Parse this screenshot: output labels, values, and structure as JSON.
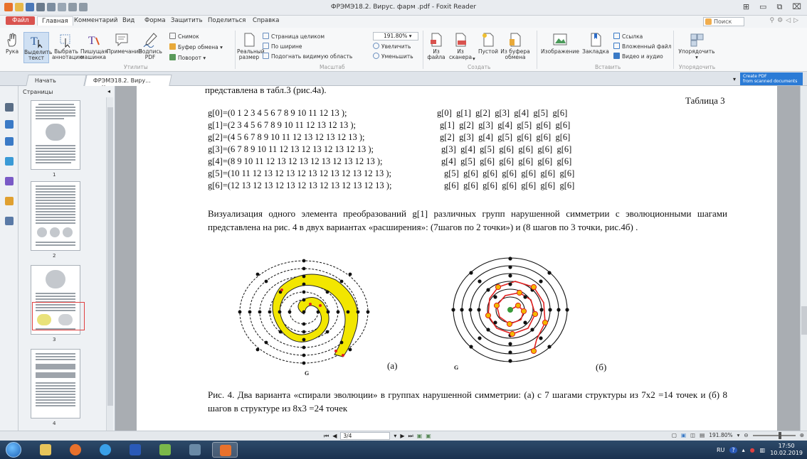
{
  "window": {
    "title": "ФРЭМЭ18.2. Вирус. фарм .pdf - Foxit Reader"
  },
  "menu": {
    "file": "Файл",
    "tabs": [
      "Главная",
      "Комментарий",
      "Вид",
      "Форма",
      "Защитить",
      "Поделиться",
      "Справка"
    ],
    "search_placeholder": "Поиск"
  },
  "ribbon": {
    "tools": {
      "hand": "Рука",
      "select_text": [
        "Выделить",
        "текст"
      ],
      "select_annot": [
        "Выбрать",
        "аннотацию"
      ],
      "typewriter": [
        "Пишущая",
        "машинка"
      ],
      "note": "Примечание",
      "sign_pdf": [
        "Подпись",
        "PDF"
      ],
      "snapshot": "Снимок",
      "clipboard": "Буфер обмена",
      "rotate": "Поворот",
      "group_label": "Утилиты"
    },
    "view": {
      "actual_size": [
        "Реальный",
        "размер"
      ],
      "fit_page": "Страница целиком",
      "fit_width": "По ширине",
      "fit_visible": "Подогнать видимую область",
      "zoom_value": "191.80%",
      "zoom_in": "Увеличить",
      "zoom_out": "Уменьшить",
      "group_label": "Масштаб"
    },
    "create": {
      "from_file": [
        "Из",
        "файла"
      ],
      "from_scanner": [
        "Из",
        "сканера"
      ],
      "blank": "Пустой",
      "from_clipboard": [
        "Из буфера",
        "обмена"
      ],
      "group_label": "Создать"
    },
    "insert": {
      "image": "Изображение",
      "bookmark": "Закладка",
      "link": "Ссылка",
      "attachment": "Вложенный файл",
      "video_audio": "Видео и аудио",
      "group_label": "Вставить"
    },
    "arrange": {
      "arrange": "Упорядочить",
      "group_label": "Упорядочить"
    }
  },
  "doc_tabs": [
    {
      "label": "Начать",
      "active": false
    },
    {
      "label": "ФРЭМЭ18.2. Виру...",
      "active": true
    }
  ],
  "promo": [
    "Create PDF",
    "from scanned documents"
  ],
  "sidebar": {
    "title": "Страницы",
    "pages": [
      "1",
      "2",
      "3",
      "4"
    ]
  },
  "document": {
    "prev_text": "представлена в табл.3 (рис.4а).",
    "table_caption": "Таблица 3",
    "g_left": [
      "g[0]=(0 1 2 3 4 5 6 7 8 9 10 11 12 13 );",
      "g[1]=(2 3 4 5 6 7 8 9 10 11 12 13 12 13 );",
      "g[2]=(4 5 6 7 8 9 10 11 12 13 12 13 12 13 );",
      "g[3]=(6 7 8 9 10 11 12 13 12 13 12 13 12 13 );",
      "g[4]=(8 9 10 11 12 13 12 13 12 13 12 13 12 13 );",
      "g[5]=(10 11 12 13 12 13 12 13 12 13 12 13 12 13 );",
      "g[6]=(12 13 12 13 12 13 12 13 12 13 12 13 12 13 );"
    ],
    "g_right": [
      "g[0]  g[1]  g[2]  g[3]  g[4]  g[5]  g[6]",
      "g[1]  g[2]  g[3]  g[4]  g[5]  g[6]  g[6]",
      "g[2]  g[3]  g[4]  g[5]  g[6]  g[6]  g[6]",
      "g[3]  g[4]  g[5]  g[6]  g[6]  g[6]  g[6]",
      "g[4]  g[5]  g[6]  g[6]  g[6]  g[6]  g[6]",
      "g[5]  g[6]  g[6]  g[6]  g[6]  g[6]  g[6]",
      "g[6]  g[6]  g[6]  g[6]  g[6]  g[6]  g[6]"
    ],
    "paragraph": "Визуализация одного элемента преобразований g[1] различных групп нарушенной симметрии с эволюционными шагами представлена на рис. 4 в двух вариантах «расширения»: (7шагов по 2 точки») и (8 шагов по 3 точки, рис.4б) .",
    "fig_a_label": "(а)",
    "fig_b_label": "(б)",
    "fig_g": "G",
    "caption": "Рис. 4. Два варианта «спирали эволюции» в группах нарушенной симметрии: (а) с 7 шагами структуры из 7х2 =14 точек и (б) 8 шагов в структуре из 8х3 =24 точек"
  },
  "statusbar": {
    "page_field": "3/4",
    "zoom": "191.80%"
  },
  "taskbar": {
    "lang": "RU",
    "time": "17:50",
    "date": "10.02.2019"
  },
  "colors": {
    "file_tab": "#d9534f",
    "spiral_yellow": "#f2e600",
    "spiral_red": "#e02020",
    "taskbar": "#1b3250"
  }
}
